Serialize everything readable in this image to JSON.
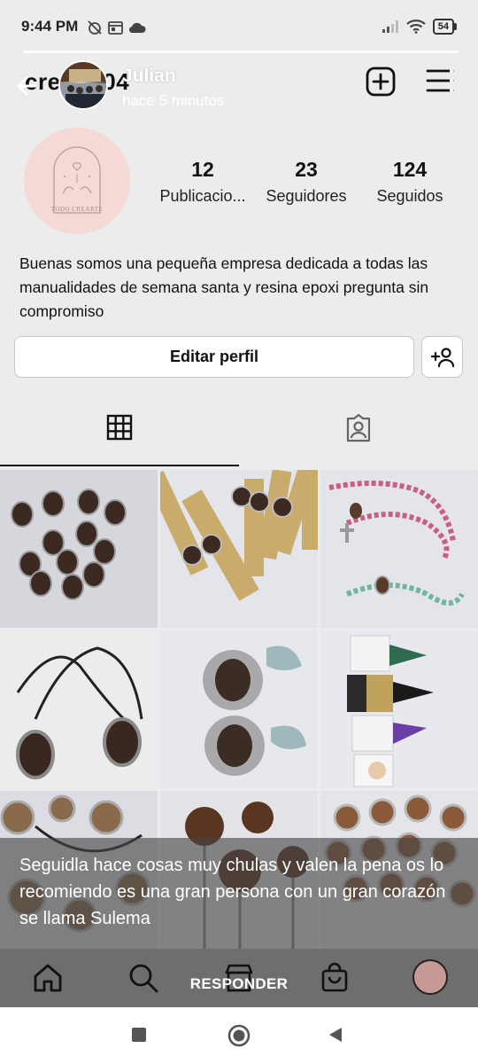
{
  "status_bar": {
    "time": "9:44 PM",
    "battery": "54",
    "icons_left": [
      "muted-alarm-icon",
      "calendar-icon",
      "cloud-icon"
    ],
    "icons_right": [
      "cellular-signal-icon",
      "wifi-icon",
      "battery-icon"
    ]
  },
  "story": {
    "username": "Julian",
    "time_ago": "hace 5 minutos",
    "caption": "Seguidla hace cosas muy chulas y valen la pena os lo recomiendo es una gran persona con un gran corazón se llama Sulema",
    "reply_label": "RESPONDER"
  },
  "profile": {
    "username_partial": "cre",
    "username_suffix": ".04",
    "avatar_logo_text": "TODO CREARTE",
    "stats": [
      {
        "value": "12",
        "label": "Publicacio..."
      },
      {
        "value": "23",
        "label": "Seguidores"
      },
      {
        "value": "124",
        "label": "Seguidos"
      }
    ],
    "bio": "Buenas somos una pequeña empresa dedicada a todas las manualidades de semana santa y resina epoxi pregunta sin compromiso",
    "edit_button": "Editar perfil"
  },
  "tabs": [
    {
      "name": "grid",
      "icon": "grid-icon",
      "active": true
    },
    {
      "name": "tagged",
      "icon": "tagged-person-icon",
      "active": false
    }
  ],
  "posts": [
    {
      "subject": "medallas religiosas ovaladas"
    },
    {
      "subject": "medallas con cinta dorada"
    },
    {
      "subject": "rosarios rosa y verde"
    },
    {
      "subject": "collares ovalados con cordón negro"
    },
    {
      "subject": "medallas con lazo azul"
    },
    {
      "subject": "figuras de nazarenos"
    },
    {
      "subject": "colgantes con imágenes"
    },
    {
      "subject": "alfileres con cúpula de resina"
    },
    {
      "subject": "medallas redondas de resina"
    }
  ],
  "bottom_nav": [
    "home-icon",
    "search-icon",
    "shop-icon",
    "bag-icon",
    "profile-avatar"
  ],
  "system_nav": [
    "recents-square-icon",
    "home-circle-icon",
    "back-triangle-icon"
  ],
  "colors": {
    "background": "#ececec",
    "overlay": "#464646",
    "bottom_nav": "#6e6e6e",
    "avatar_pink": "#f5d9d6"
  }
}
